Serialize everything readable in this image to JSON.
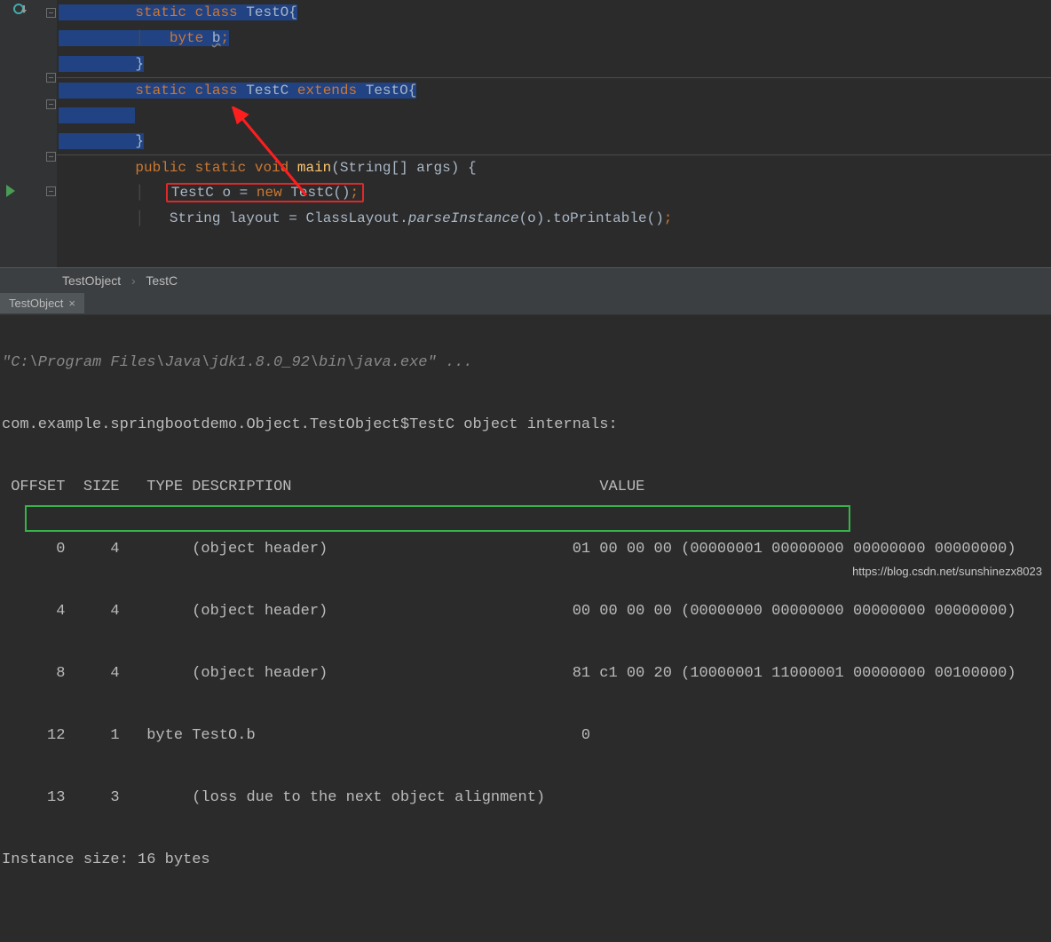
{
  "code": {
    "l1": "static class TestO{",
    "l2": "byte b;",
    "l3": "}",
    "l4": "static class TestC extends TestO{",
    "l5": "",
    "l6": "}",
    "l7": "public static void main(String[] args) {",
    "l8": "TestC o = new TestC();",
    "l9": "String layout = ClassLayout.parseInstance(o).toPrintable();"
  },
  "breadcrumb": {
    "a": "TestObject",
    "b": "TestC",
    "sep": "›"
  },
  "run": {
    "tab_label": "TestObject",
    "cmdline": "\"C:\\Program Files\\Java\\jdk1.8.0_92\\bin\\java.exe\" ...",
    "objinternals": "com.example.springbootdemo.Object.TestObject$TestC object internals:",
    "hdr_offset": " OFFSET",
    "hdr_size": "SIZE",
    "hdr_type": "TYPE DESCRIPTION",
    "hdr_value": "VALUE",
    "rows": [
      {
        "off": "0",
        "sz": "4",
        "td": "     (object header)",
        "val": "01 00 00 00 (00000001 00000000 00000000 00000000)"
      },
      {
        "off": "4",
        "sz": "4",
        "td": "     (object header)",
        "val": "00 00 00 00 (00000000 00000000 00000000 00000000)"
      },
      {
        "off": "8",
        "sz": "4",
        "td": "     (object header)",
        "val": "81 c1 00 20 (10000001 11000001 00000000 00100000)"
      },
      {
        "off": "12",
        "sz": "1",
        "td": "byte TestO.b",
        "val": "0"
      },
      {
        "off": "13",
        "sz": "3",
        "td": "     (loss due to the next object alignment)",
        "val": ""
      }
    ],
    "instsize": "Instance size: 16 bytes"
  },
  "watermark": "https://blog.csdn.net/sunshinezx8023"
}
